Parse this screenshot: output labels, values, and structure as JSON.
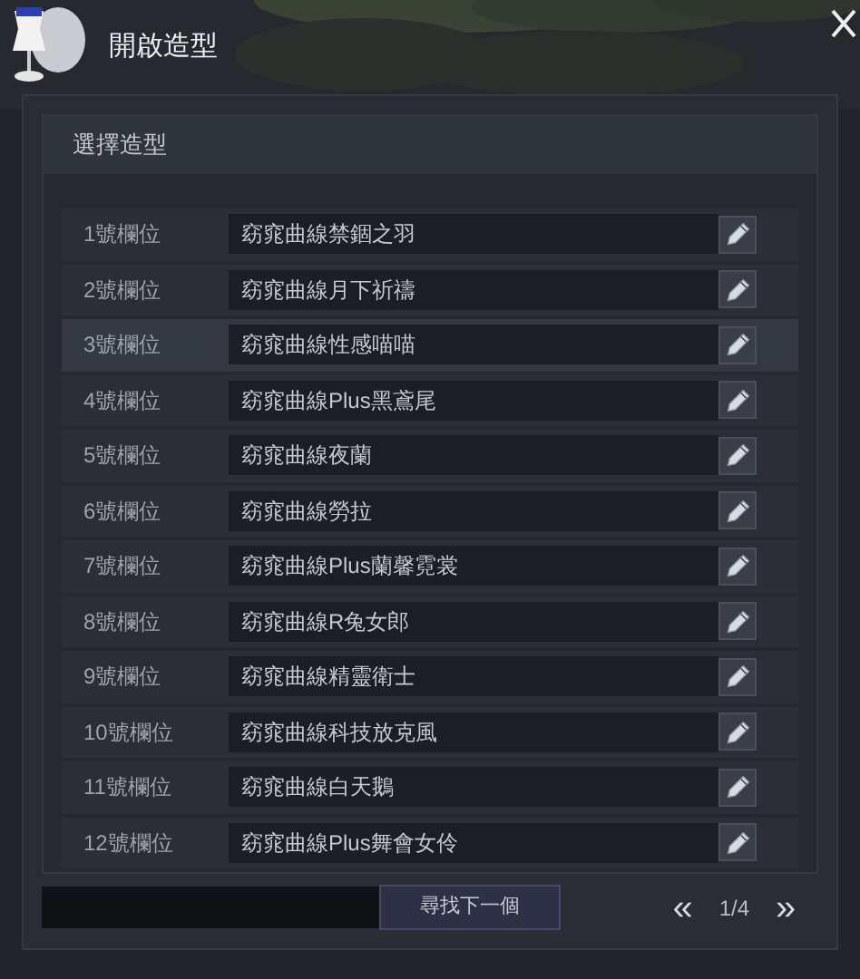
{
  "window": {
    "title": "開啟造型"
  },
  "section": {
    "title": "選擇造型"
  },
  "slots": [
    {
      "label": "1號欄位",
      "name": "窈窕曲線禁錮之羽",
      "selected": false
    },
    {
      "label": "2號欄位",
      "name": "窈窕曲線月下祈禱",
      "selected": false
    },
    {
      "label": "3號欄位",
      "name": "窈窕曲線性感喵喵",
      "selected": true
    },
    {
      "label": "4號欄位",
      "name": "窈窕曲線Plus黑鳶尾",
      "selected": false
    },
    {
      "label": "5號欄位",
      "name": "窈窕曲線夜蘭",
      "selected": false
    },
    {
      "label": "6號欄位",
      "name": "窈窕曲線勞拉",
      "selected": false
    },
    {
      "label": "7號欄位",
      "name": "窈窕曲線Plus蘭馨霓裳",
      "selected": false
    },
    {
      "label": "8號欄位",
      "name": "窈窕曲線R兔女郎",
      "selected": false
    },
    {
      "label": "9號欄位",
      "name": "窈窕曲線精靈衛士",
      "selected": false
    },
    {
      "label": "10號欄位",
      "name": "窈窕曲線科技放克風",
      "selected": false
    },
    {
      "label": "11號欄位",
      "name": "窈窕曲線白天鵝",
      "selected": false
    },
    {
      "label": "12號欄位",
      "name": "窈窕曲線Plus舞會女伶",
      "selected": false
    }
  ],
  "footer": {
    "find_next": "尋找下一個",
    "prev": "«",
    "page": "1/4",
    "next": "»"
  }
}
